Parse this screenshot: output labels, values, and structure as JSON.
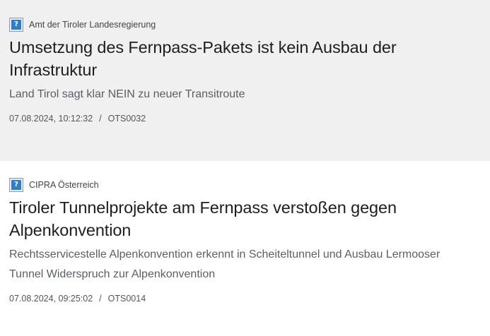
{
  "articles": [
    {
      "source": "Amt der Tiroler Landesregierung",
      "source_icon": "question-icon",
      "title": "Umsetzung des Fernpass-Pakets ist kein Ausbau der Infrastruktur",
      "subtitle": "Land Tirol sagt klar NEIN zu neuer Transitroute",
      "datetime": "07.08.2024, 10:12:32",
      "separator": "/",
      "ots_id": "OTS0032"
    },
    {
      "source": "CIPRA Österreich",
      "source_icon": "question-icon",
      "title": "Tiroler Tunnelprojekte am Fernpass verstoßen gegen Alpenkonvention",
      "subtitle": "Rechtsservicestelle Alpenkonvention erkennt in Scheiteltunnel und Ausbau Lermooser Tunnel Widerspruch zur Alpenkonvention",
      "datetime": "07.08.2024, 09:25:02",
      "separator": "/",
      "ots_id": "OTS0014"
    }
  ],
  "colors": {
    "highlight_background": "#f0f0f0",
    "icon_blue": "#2f7fc8"
  }
}
